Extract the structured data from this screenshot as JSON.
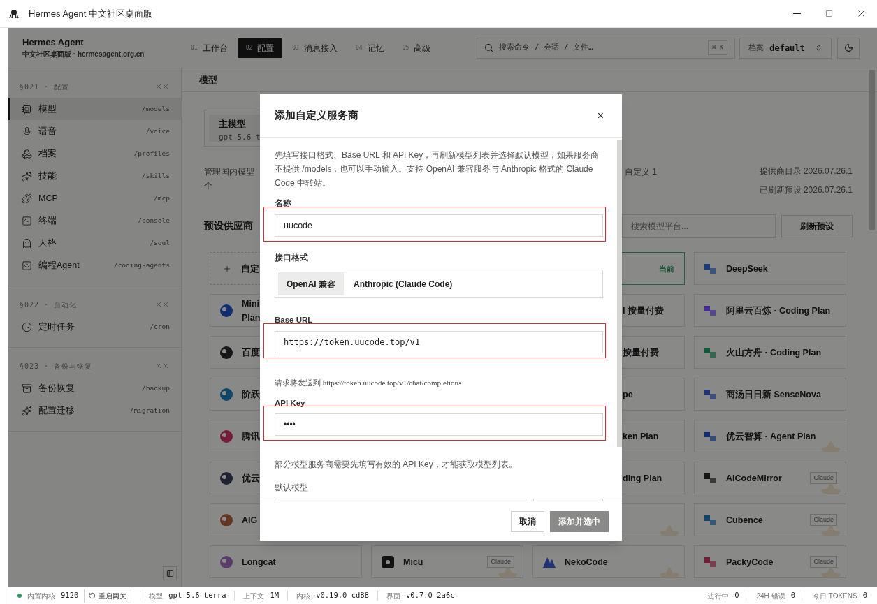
{
  "window": {
    "title": "Hermes Agent 中文社区桌面版"
  },
  "brand": {
    "name": "Hermes Agent",
    "subtitle": "中文社区桌面版 · hermesagent.org.cn"
  },
  "nav": [
    {
      "index": "01",
      "label": "工作台",
      "selected": false
    },
    {
      "index": "02",
      "label": "配置",
      "selected": true
    },
    {
      "index": "03",
      "label": "消息接入",
      "selected": false
    },
    {
      "index": "04",
      "label": "记忆",
      "selected": false
    },
    {
      "index": "05",
      "label": "高级",
      "selected": false
    }
  ],
  "search": {
    "placeholder": "搜索命令 / 会话 / 文件…",
    "shortcut": "⌘ K"
  },
  "profile": {
    "label": "档案",
    "value": "default"
  },
  "sidebar": {
    "groups": [
      {
        "code": "§021 · 配置",
        "items": [
          {
            "label": "模型",
            "route": "/models",
            "selected": true
          },
          {
            "label": "语音",
            "route": "/voice",
            "selected": false
          },
          {
            "label": "档案",
            "route": "/profiles",
            "selected": false
          },
          {
            "label": "技能",
            "route": "/skills",
            "selected": false
          },
          {
            "label": "MCP",
            "route": "/mcp",
            "selected": false
          },
          {
            "label": "终端",
            "route": "/console",
            "selected": false
          },
          {
            "label": "人格",
            "route": "/soul",
            "selected": false
          },
          {
            "label": "编程Agent",
            "route": "/coding-agents",
            "selected": false
          }
        ]
      },
      {
        "code": "§022 · 自动化",
        "items": [
          {
            "label": "定时任务",
            "route": "/cron",
            "selected": false
          }
        ]
      },
      {
        "code": "§023 · 备份与恢复",
        "items": [
          {
            "label": "备份恢复",
            "route": "/backup",
            "selected": false
          },
          {
            "label": "配置迁移",
            "route": "/migration",
            "selected": false
          }
        ]
      }
    ]
  },
  "page": {
    "title": "模型",
    "main_model": {
      "label": "主模型",
      "value": "gpt-5.6-t"
    },
    "description_start": "管理国内模型",
    "description_end": "自定义 1",
    "description_line2": "个",
    "catalog": "提供商目录 2026.07.26.1",
    "refreshed": "已刷新预设 2026.07.26.1",
    "section": "预设供应商",
    "search_placeholder": "搜索模型平台...",
    "refresh_button": "刷新预设",
    "cards": [
      {
        "kind": "add",
        "name": "自定"
      },
      {
        "kind": "covered"
      },
      {
        "kind": "partial",
        "badge": "当前",
        "current": true,
        "starred": false
      },
      {
        "kind": "provider",
        "name": "DeepSeek",
        "current": false,
        "starred": false
      },
      {
        "kind": "provider",
        "name": "Mini\nPlan",
        "current": false
      },
      {
        "kind": "covered"
      },
      {
        "kind": "partial",
        "name": "I 按量付费",
        "current": false,
        "starred": false
      },
      {
        "kind": "provider",
        "name": "阿里云百炼 · Coding Plan",
        "current": false,
        "starred": false
      },
      {
        "kind": "provider",
        "name": "百度",
        "current": false
      },
      {
        "kind": "covered"
      },
      {
        "kind": "partial",
        "name": "按量付费",
        "current": false,
        "starred": false
      },
      {
        "kind": "provider",
        "name": "火山方舟 · Coding Plan",
        "current": false,
        "starred": false
      },
      {
        "kind": "provider",
        "name": "阶跃",
        "current": false
      },
      {
        "kind": "covered"
      },
      {
        "kind": "partial",
        "name": "pe",
        "current": false,
        "starred": false
      },
      {
        "kind": "provider",
        "name": "商汤日日新 SenseNova",
        "current": false,
        "starred": false
      },
      {
        "kind": "provider",
        "name": "腾讯",
        "current": false
      },
      {
        "kind": "covered"
      },
      {
        "kind": "partial",
        "name": "ken Plan",
        "current": false,
        "starred": false
      },
      {
        "kind": "provider",
        "name": "优云智算 · Agent Plan",
        "current": false,
        "starred": true
      },
      {
        "kind": "provider",
        "name": "优云",
        "current": false
      },
      {
        "kind": "covered"
      },
      {
        "kind": "partial",
        "name": "ding Plan",
        "current": false,
        "starred": false
      },
      {
        "kind": "provider",
        "name": "AICodeMirror",
        "badge": "Claude",
        "current": false,
        "starred": true
      },
      {
        "kind": "provider",
        "name": "AIG",
        "current": false
      },
      {
        "kind": "covered"
      },
      {
        "kind": "partial",
        "current": false,
        "starred": true
      },
      {
        "kind": "provider",
        "name": "Cubence",
        "badge": "Claude",
        "current": false,
        "starred": true
      },
      {
        "kind": "provider",
        "name": "Longcat",
        "current": false,
        "starred": false
      },
      {
        "kind": "provider",
        "name": "Micu",
        "badge": "Claude",
        "current": false,
        "starred": true
      },
      {
        "kind": "provider",
        "name": "NekoCode",
        "current": false,
        "starred": true
      },
      {
        "kind": "provider",
        "name": "PackyCode",
        "badge": "Claude",
        "current": false,
        "starred": true
      }
    ]
  },
  "dialog": {
    "title": "添加自定义服务商",
    "close": "×",
    "description": "先填写接口格式、Base URL 和 API Key，再刷新模型列表并选择默认模型；如果服务商不提供 /models，也可以手动输入。支持 OpenAI 兼容服务与 Anthropic 格式的 Claude Code 中转站。",
    "name": {
      "label": "名称",
      "value": "uucode",
      "highlighted": true
    },
    "format": {
      "label": "接口格式",
      "options": [
        {
          "label": "OpenAI 兼容",
          "selected": true
        },
        {
          "label": "Anthropic (Claude Code)",
          "selected": false
        }
      ]
    },
    "base_url": {
      "label": "Base URL",
      "value": "https://token.uucode.top/v1",
      "highlighted": true
    },
    "endpoint_hint": "请求将发送到",
    "endpoint_url": "https://token.uucode.top/v1/chat/completions",
    "api_key": {
      "label": "API Key",
      "value": "••••",
      "highlighted": true
    },
    "key_note": "部分模型服务商需要先填写有效的 API Key，才能获取模型列表。",
    "default_model": {
      "label": "默认模型"
    },
    "cancel": "取消",
    "confirm": {
      "label": "添加并选中",
      "disabled": true
    }
  },
  "status_bar": {
    "kernel": {
      "label": "内置内核",
      "value": "9120",
      "running": true
    },
    "restart": "重启网关",
    "items": [
      {
        "label": "模型",
        "value": "gpt-5.6-terra"
      },
      {
        "label": "上下文",
        "value": "1M"
      },
      {
        "label": "内核",
        "value": "v0.19.0 cd88"
      },
      {
        "label": "界面",
        "value": "v0.7.0 2a6c"
      }
    ],
    "counters": [
      {
        "label": "进行中",
        "value": "0"
      },
      {
        "label": "24H 错误",
        "value": "0"
      },
      {
        "label": "今日 TOKENS",
        "value": "0"
      }
    ]
  }
}
